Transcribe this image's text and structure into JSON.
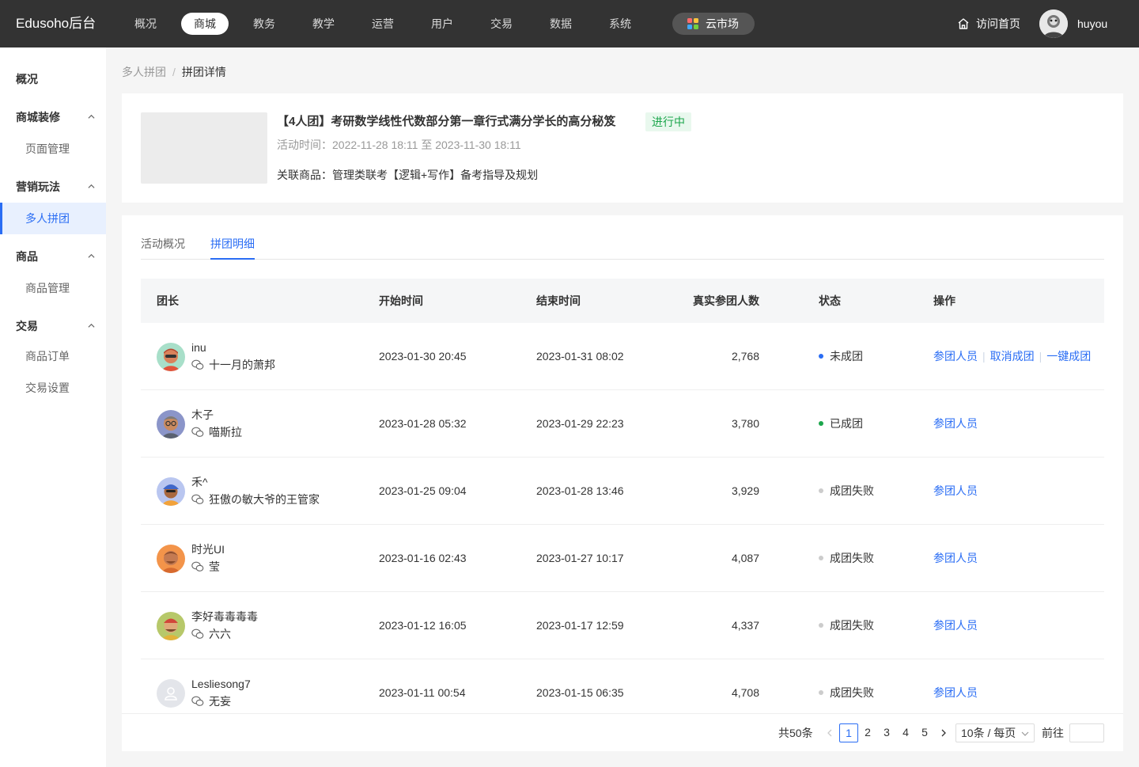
{
  "app": {
    "logo": "Edusoho后台",
    "username": "huyou",
    "home_link": "访问首页",
    "market": "云市场"
  },
  "nav": [
    "概况",
    "商城",
    "教务",
    "教学",
    "运营",
    "用户",
    "交易",
    "数据",
    "系统"
  ],
  "sidebar": {
    "overview": "概况",
    "groups": [
      {
        "label": "商城装修",
        "items": [
          "页面管理"
        ]
      },
      {
        "label": "营销玩法",
        "items": [
          "多人拼团"
        ]
      },
      {
        "label": "商品",
        "items": [
          "商品管理"
        ]
      },
      {
        "label": "交易",
        "items": [
          "商品订单",
          "交易设置"
        ]
      }
    ]
  },
  "breadcrumb": {
    "parent": "多人拼团",
    "sep": "/",
    "current": "拼团详情"
  },
  "activity": {
    "title": "【4人团】考研数学线性代数部分第一章行式满分学长的高分秘笈",
    "status": "进行中",
    "time": "活动时间：2022-11-28 18:11 至 2023-11-30 18:11",
    "goods": "关联商品：管理类联考【逻辑+写作】备考指导及规划"
  },
  "tabs": [
    "活动概况",
    "拼团明细"
  ],
  "table": {
    "headers": [
      "团长",
      "开始时间",
      "结束时间",
      "真实参团人数",
      "状态",
      "操作"
    ],
    "rows": [
      {
        "name": "inu",
        "wx": "十一月的萧邦",
        "start": "2023-01-30 20:45",
        "end": "2023-01-31 08:02",
        "count": "2,768",
        "status": "未成团",
        "status_color": "#2a6df4",
        "ops": [
          "参团人员",
          "取消成团",
          "一键成团"
        ]
      },
      {
        "name": "木子",
        "wx": "喵斯拉",
        "start": "2023-01-28 05:32",
        "end": "2023-01-29 22:23",
        "count": "3,780",
        "status": "已成团",
        "status_color": "#1ca64c",
        "ops": [
          "参团人员"
        ]
      },
      {
        "name": "禾^",
        "wx": "狂傲の敏大爷的王管家",
        "start": "2023-01-25 09:04",
        "end": "2023-01-28 13:46",
        "count": "3,929",
        "status": "成团失败",
        "status_color": "#cccccc",
        "ops": [
          "参团人员"
        ]
      },
      {
        "name": "时光UI",
        "wx": "莹",
        "start": "2023-01-16 02:43",
        "end": "2023-01-27 10:17",
        "count": "4,087",
        "status": "成团失败",
        "status_color": "#cccccc",
        "ops": [
          "参团人员"
        ]
      },
      {
        "name": "李好毒毒毒毒",
        "wx": "六六",
        "start": "2023-01-12 16:05",
        "end": "2023-01-17 12:59",
        "count": "4,337",
        "status": "成团失败",
        "status_color": "#cccccc",
        "ops": [
          "参团人员"
        ]
      },
      {
        "name": "Lesliesong7",
        "wx": "无妄",
        "start": "2023-01-11 00:54",
        "end": "2023-01-15 06:35",
        "count": "4,708",
        "status": "成团失败",
        "status_color": "#cccccc",
        "ops": [
          "参团人员"
        ]
      }
    ]
  },
  "pagination": {
    "total": "共50条",
    "pages": [
      "1",
      "2",
      "3",
      "4",
      "5"
    ],
    "current": "1",
    "page_size": "10条 / 每页",
    "goto": "前往"
  },
  "colors": {
    "accent": "#2a6df4",
    "topbar": "#333333",
    "success": "#1ca64c"
  }
}
